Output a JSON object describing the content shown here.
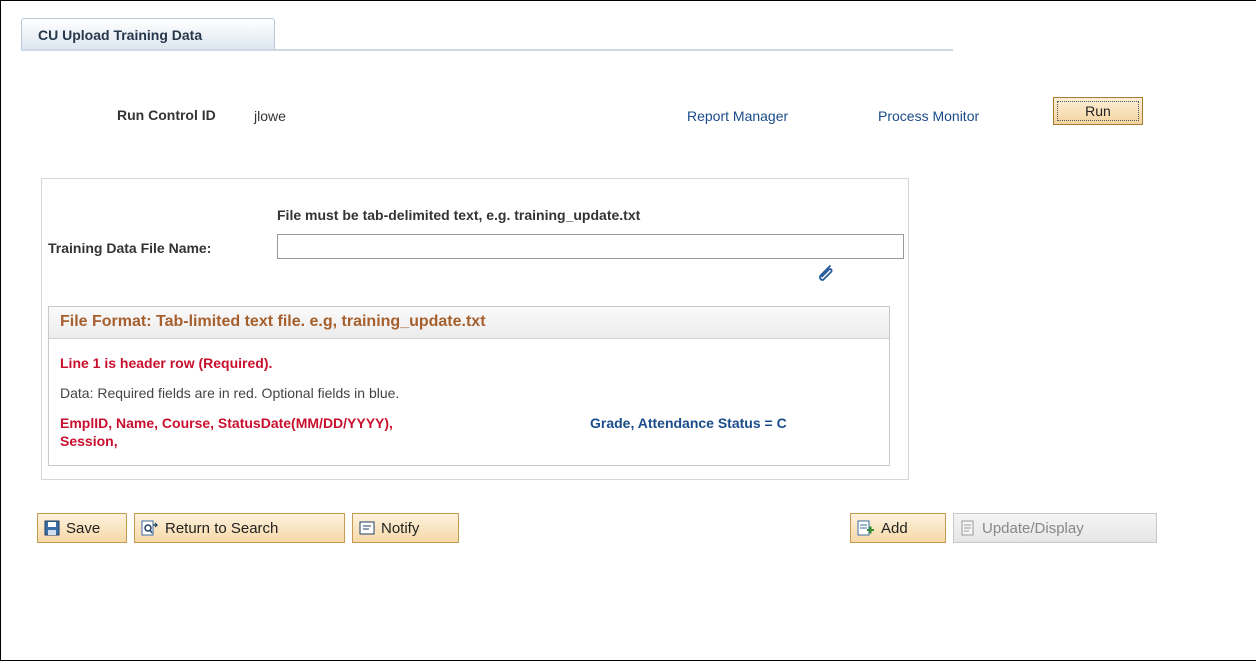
{
  "tab": {
    "label": "CU Upload Training Data"
  },
  "run_control": {
    "label": "Run Control ID",
    "value": "jlowe",
    "report_manager": "Report Manager",
    "process_monitor": "Process Monitor",
    "run": "Run"
  },
  "form": {
    "hint": "File must be tab-delimited text, e.g. training_update.txt",
    "file_label": "Training Data File Name:",
    "file_value": ""
  },
  "format": {
    "title": "File Format: Tab-limited text file. e.g, training_update.txt",
    "line1": "Line 1 is header row (Required).",
    "data_note": "Data: Required fields are in red. Optional fields in blue.",
    "required_fields_line1": "EmplID, Name, Course, StatusDate(MM/DD/YYYY),",
    "required_fields_line2": "Session,",
    "optional_fields": "Grade, Attendance Status = C",
    "colors": {
      "required": "#c8102e",
      "optional": "#1b4c8a",
      "title": "#a6602e"
    }
  },
  "toolbar": {
    "save": "Save",
    "return_to_search": "Return to Search",
    "notify": "Notify",
    "add": "Add",
    "update_display": "Update/Display"
  },
  "icons": [
    "attach-icon",
    "save-icon",
    "return-to-search-icon",
    "notify-icon",
    "add-icon",
    "update-display-icon"
  ]
}
